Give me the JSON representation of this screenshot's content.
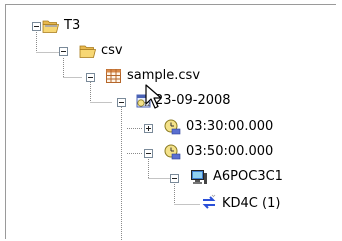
{
  "tree": {
    "nodes": [
      {
        "label": "T3",
        "icon": "folder-open-icon",
        "state": "expanded"
      },
      {
        "label": "csv",
        "icon": "folder-open-icon",
        "state": "expanded"
      },
      {
        "label": "sample.csv",
        "icon": "table-icon",
        "state": "expanded"
      },
      {
        "label": "23-09-2008",
        "icon": "calendar-clock-icon",
        "state": "expanded"
      },
      {
        "label": "03:30:00.000",
        "icon": "clock-icon",
        "state": "collapsed"
      },
      {
        "label": "03:50:00.000",
        "icon": "clock-icon",
        "state": "expanded"
      },
      {
        "label": "A6POC3C1",
        "icon": "computer-icon",
        "state": "expanded"
      },
      {
        "label": "KD4C (1)",
        "icon": "exchange-arrows-icon",
        "state": "leaf"
      }
    ]
  },
  "colors": {
    "folder": "#f3cd6a",
    "table_grid": "#c07a3a",
    "clock_face": "#f4e28a",
    "arrow_blue": "#2a4fd8"
  }
}
